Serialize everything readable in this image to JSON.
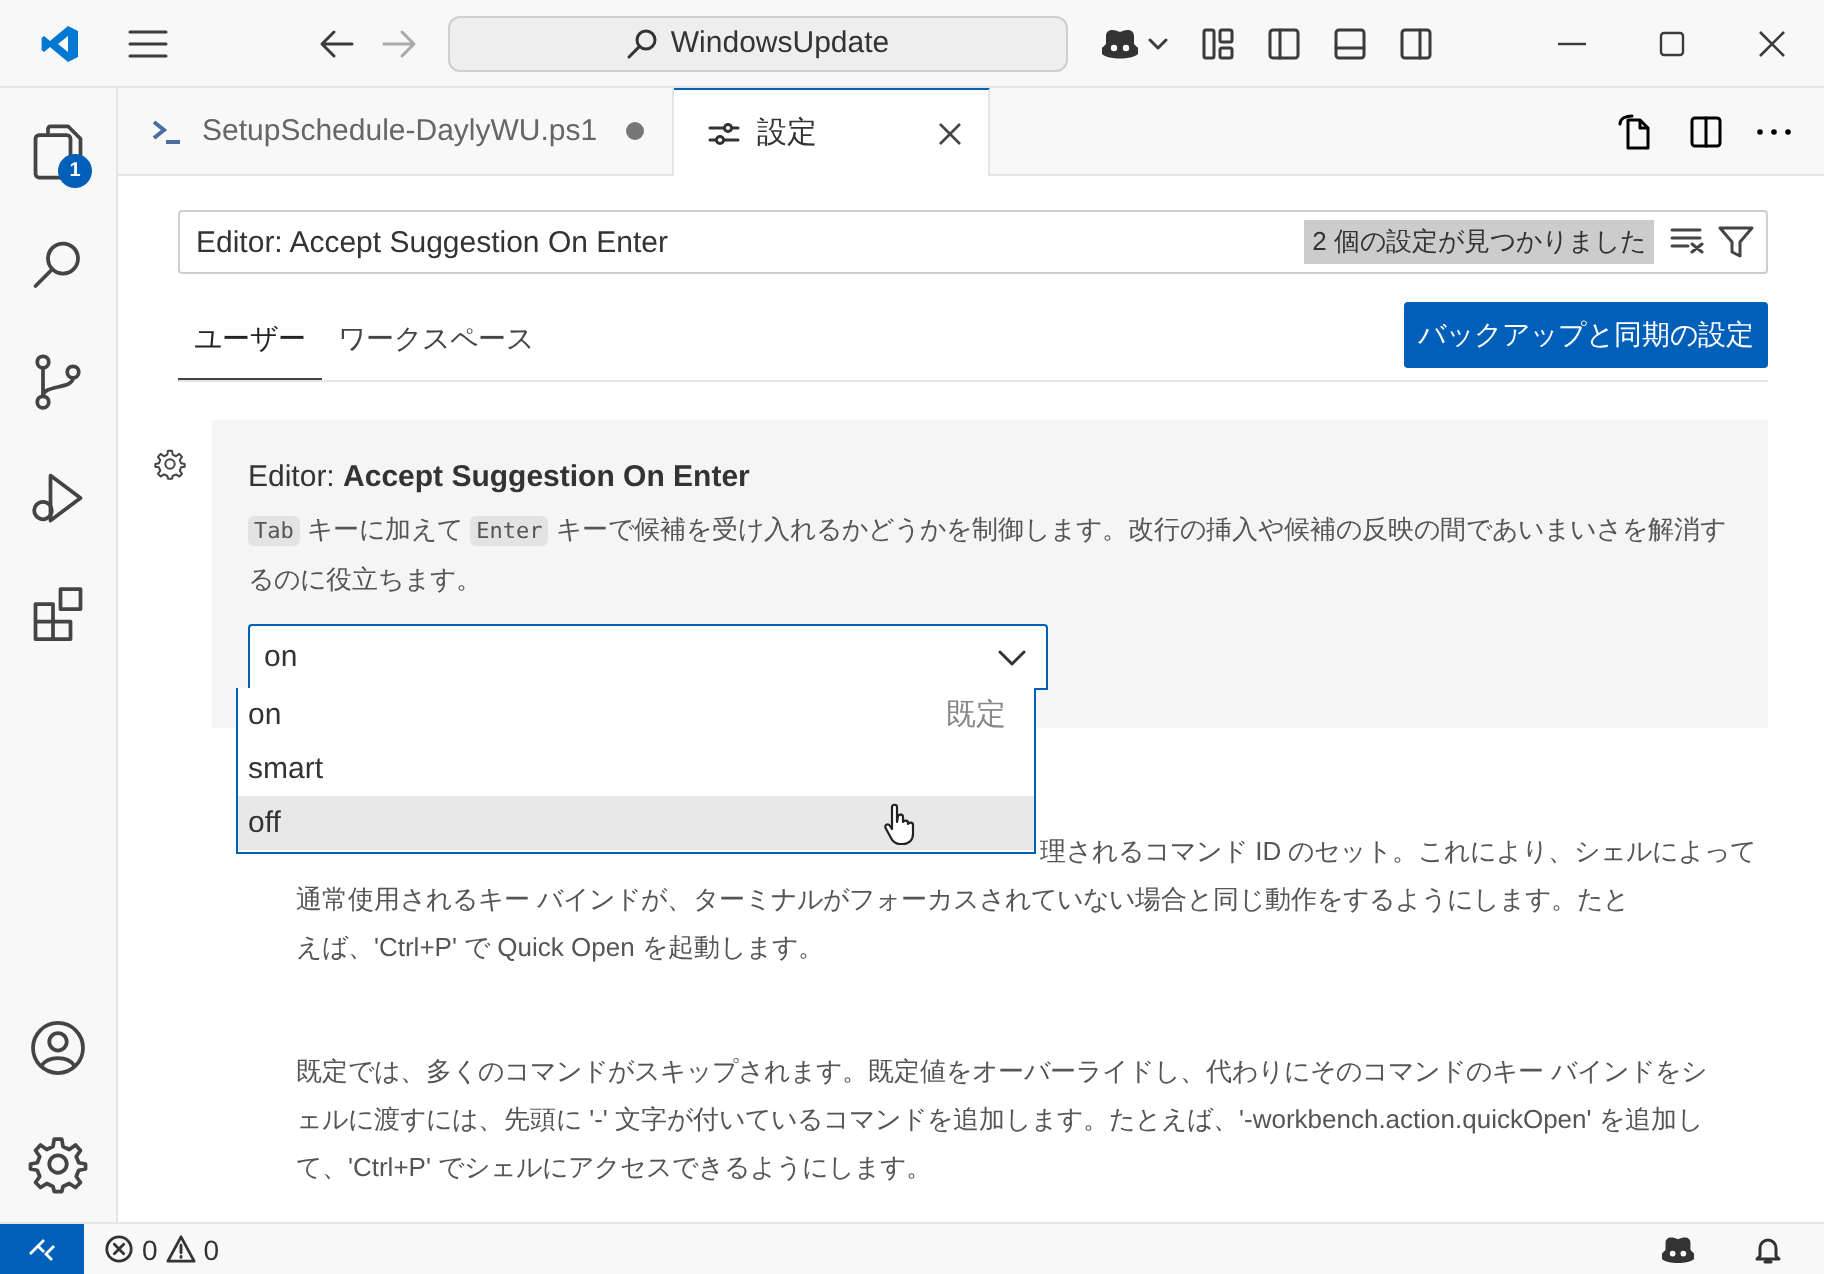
{
  "title_bar": {
    "search": "WindowsUpdate"
  },
  "activity_bar": {
    "top": [
      {
        "kind": "files",
        "badge": "1"
      },
      {
        "kind": "search"
      },
      {
        "kind": "branch"
      },
      {
        "kind": "debug"
      },
      {
        "kind": "extensions"
      }
    ],
    "bottom": [
      {
        "kind": "account"
      },
      {
        "kind": "gear"
      }
    ]
  },
  "editor_tabs": [
    {
      "label": "SetupSchedule-DaylyWU.ps1",
      "kind": "terminal",
      "selected": false,
      "dirty": true
    },
    {
      "label": "設定",
      "kind": "settings",
      "selected": true,
      "dirty": false
    }
  ],
  "settings": {
    "search": {
      "value": "Editor: Accept Suggestion On Enter",
      "result_count": "2 個の設定が見つかりました"
    },
    "scope_tabs": [
      {
        "label": "ユーザー",
        "selected": true
      },
      {
        "label": "ワークスペース",
        "selected": false
      }
    ],
    "sync_button": "バックアップと同期の設定",
    "setting": {
      "title": "Editor: **Accept Suggestion On Enter**",
      "description": [
        {
          "kind": "code",
          "text": "Tab"
        },
        {
          "kind": "text",
          "text": " キーに加えて "
        },
        {
          "kind": "code",
          "text": "Enter"
        },
        {
          "kind": "text",
          "text": " キーで候補を受け入れるかどうかを制御します。改行の挿入や候補の反映の間であいまいさを解消するのに役立ちます。"
        }
      ],
      "dropdown": {
        "value": "on",
        "expanded": true,
        "options": [
          {
            "label": "on",
            "note": "既定",
            "hovered": false
          },
          {
            "label": "smart",
            "hovered": false
          },
          {
            "label": "off",
            "hovered": true
          }
        ]
      }
    },
    "next_setting": {
      "visible_fragment": "理されるコマンド ID のセット。これにより、シェルによって",
      "continuation": "通常使用されるキー バインドが、ターミナルがフォーカスされていない場合と同じ動作をするようにします。たとえば、'Ctrl+P' で Quick Open を起動します。",
      "paragraph": "既定では、多くのコマンドがスキップされます。既定値をオーバーライドし、代わりにそのコマンドのキー バインドをシェルに渡すには、先頭に '-' 文字が付いているコマンドを追加します。たとえば、'-workbench.action.quickOpen' を追加して、'Ctrl+P' でシェルにアクセスできるようにします。"
    }
  },
  "status_bar": {
    "errors": "0",
    "warnings": "0"
  }
}
